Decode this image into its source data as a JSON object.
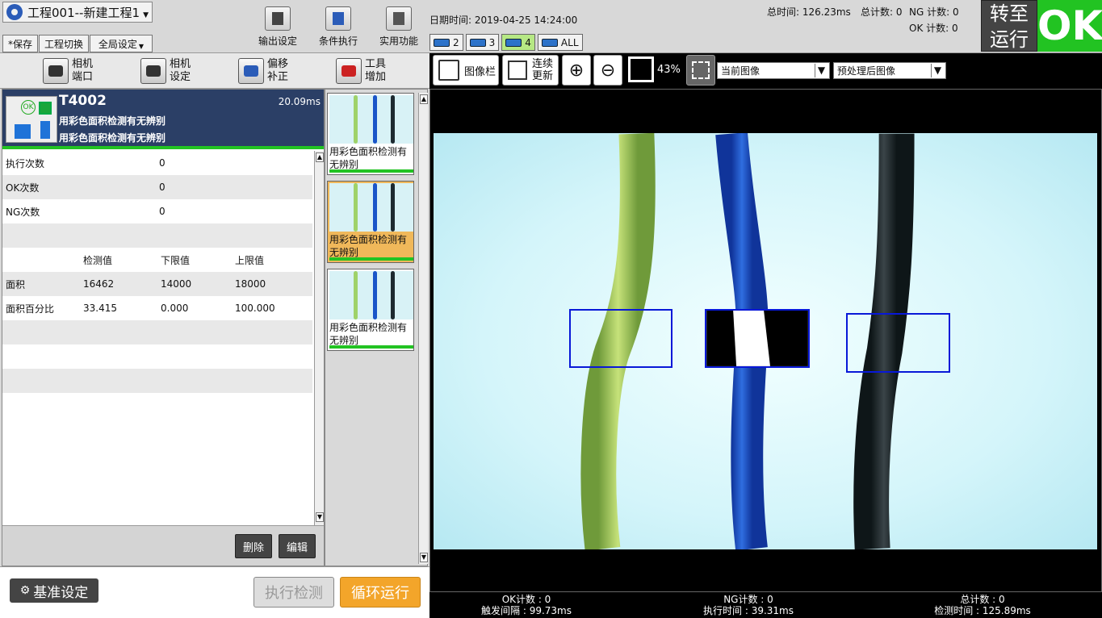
{
  "project": {
    "title": "工程001--新建工程1"
  },
  "menu": {
    "save": "*保存",
    "switch_project": "工程切换",
    "global_settings": "全局设定"
  },
  "top_tools": [
    {
      "label": "输出设定",
      "icon": "output-icon"
    },
    {
      "label": "条件执行",
      "icon": "condition-icon"
    },
    {
      "label": "实用功能",
      "icon": "tools-icon"
    }
  ],
  "datetime": {
    "label": "日期时间: 2019-04-25 14:24:00"
  },
  "stats": {
    "total_time": "总时间:  126.23ms",
    "total_count": "总计数: 0",
    "ng_count": "NG 计数: 0",
    "ok_count": "OK 计数: 0"
  },
  "cam_tabs": [
    {
      "label": "2",
      "active": false
    },
    {
      "label": "3",
      "active": false
    },
    {
      "label": "4",
      "active": true
    },
    {
      "label": "ALL",
      "active": false
    }
  ],
  "run_switch": {
    "line1": "转至",
    "line2": "运行"
  },
  "result": {
    "value": "OK",
    "color": "#22c322"
  },
  "left_toolbar": [
    {
      "line1": "相机",
      "line2": "端口",
      "icon": "camera-port-icon"
    },
    {
      "line1": "相机",
      "line2": "设定",
      "icon": "camera-settings-icon"
    },
    {
      "line1": "偏移",
      "line2": "补正",
      "icon": "offset-icon"
    },
    {
      "line1": "工具",
      "line2": "增加",
      "icon": "add-tool-icon"
    }
  ],
  "tool": {
    "id": "T4002",
    "time": "20.09ms",
    "name1": "用彩色面积检测有无辨别",
    "name2": "用彩色面积检测有无辨别"
  },
  "counts": [
    {
      "key": "执行次数",
      "value": "0"
    },
    {
      "key": "OK次数",
      "value": "0"
    },
    {
      "key": "NG次数",
      "value": "0"
    }
  ],
  "measure_table": {
    "headers": [
      "",
      "检测值",
      "下限值",
      "上限值"
    ],
    "rows": [
      [
        "面积",
        "16462",
        "14000",
        "18000"
      ],
      [
        "面积百分比",
        "33.415",
        "0.000",
        "100.000"
      ]
    ]
  },
  "panel_buttons": {
    "delete": "删除",
    "edit": "编辑"
  },
  "thumbs": [
    {
      "caption": "用彩色面积检测有无辨别",
      "selected": false
    },
    {
      "caption": "用彩色面积检测有无辨别",
      "selected": true
    },
    {
      "caption": "用彩色面积检测有无辨别",
      "selected": false
    }
  ],
  "bottom": {
    "reference": "基准设定",
    "execute": "执行检测",
    "loop": "循环运行"
  },
  "view_toolbar": {
    "image_bar": "图像栏",
    "continuous1": "连续",
    "continuous2": "更新",
    "zoom": "43%",
    "select1": "当前图像",
    "select2": "预处理后图像"
  },
  "status_bar": {
    "ok": "OK计数 : 0",
    "trigger": "触发间隔 : 99.73ms",
    "ng": "NG计数 : 0",
    "exec_time": "执行时间 : 39.31ms",
    "total": "总计数 : 0",
    "detect_time": "检测时间 : 125.89ms"
  }
}
